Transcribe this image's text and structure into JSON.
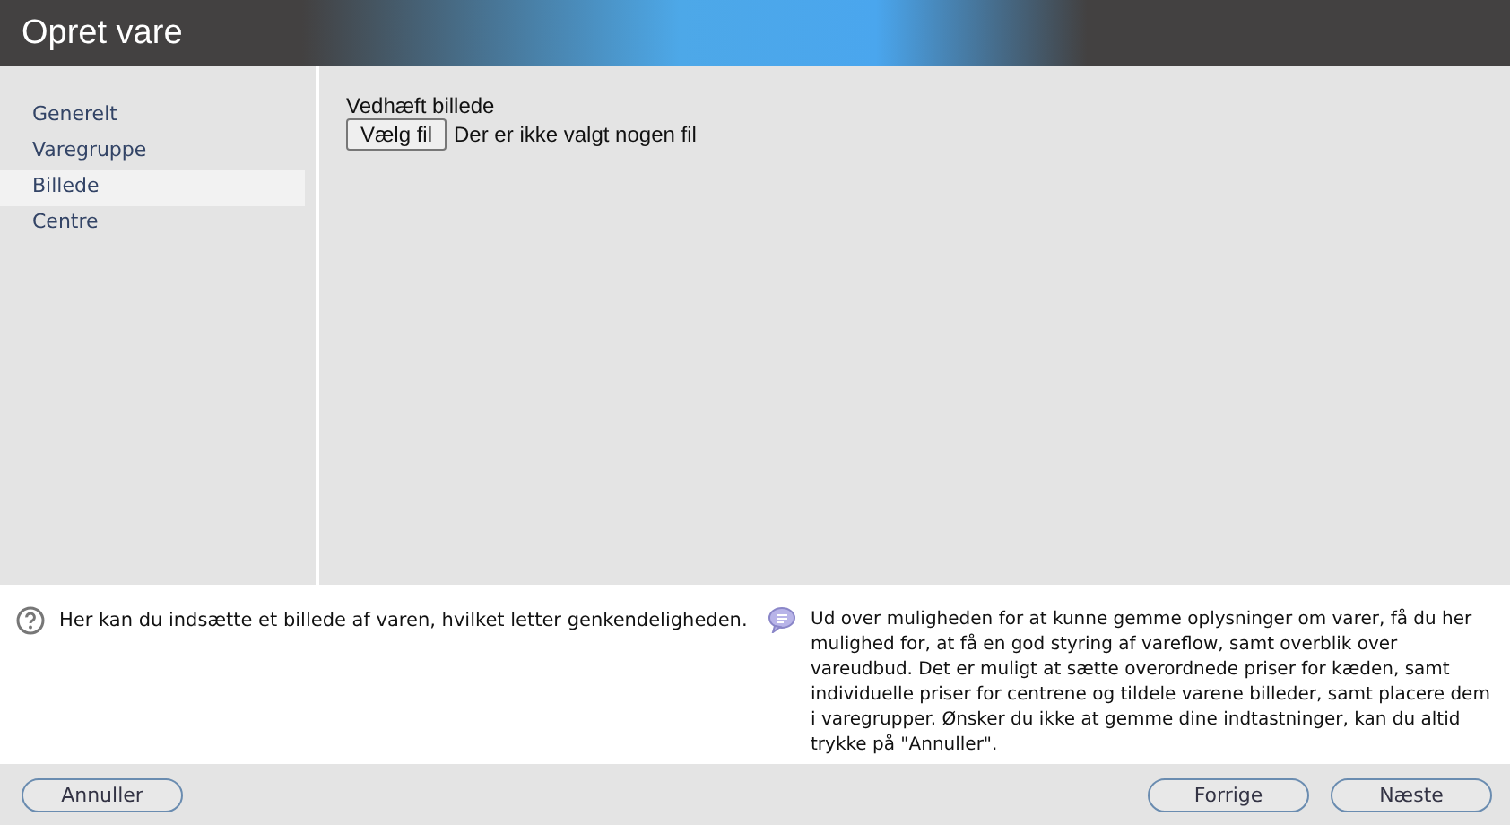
{
  "window": {
    "title": "Opret vare"
  },
  "sidebar": {
    "items": [
      {
        "label": "Generelt",
        "selected": false
      },
      {
        "label": "Varegruppe",
        "selected": false
      },
      {
        "label": "Billede",
        "selected": true
      },
      {
        "label": "Centre",
        "selected": false
      }
    ]
  },
  "form": {
    "label": "Vedhæft billede",
    "file_button": "Vælg fil",
    "file_status": "Der er ikke valgt nogen fil"
  },
  "help": {
    "hint": "Her kan du indsætte et billede af varen, hvilket letter genkendeligheden.",
    "info": "Ud over muligheden for at kunne gemme oplysninger om varer, få du her mulighed for, at få en god styring af vareflow, samt overblik over vareudbud. Det er muligt at sætte overordnede priser for kæden, samt individuelle priser for centrene og tildele varene billeder, samt placere dem i varegrupper. Ønsker du ikke at gemme dine indtastninger, kan du altid trykke på \"Annuller\"."
  },
  "buttons": {
    "cancel": "Annuller",
    "previous": "Forrige",
    "next": "Næste"
  }
}
